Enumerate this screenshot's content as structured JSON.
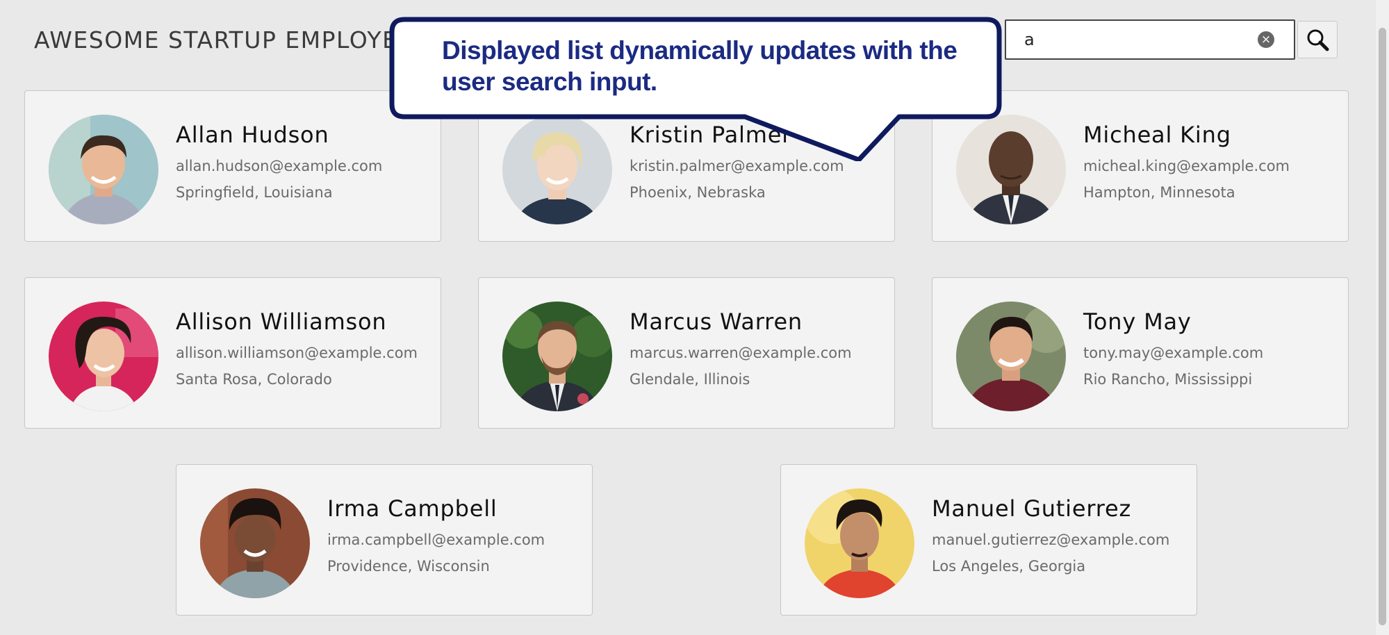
{
  "header": {
    "title": "AWESOME STARTUP EMPLOYEES"
  },
  "search": {
    "value": "a",
    "clear_icon": "clear-icon",
    "search_icon": "magnifier-icon"
  },
  "callout": {
    "text": "Displayed list dynamically updates with the\n user search input."
  },
  "employees": [
    {
      "name": "Allan Hudson",
      "email": "allan.hudson@example.com",
      "location": "Springfield, Louisiana"
    },
    {
      "name": "Kristin Palmer",
      "email": "kristin.palmer@example.com",
      "location": "Phoenix, Nebraska"
    },
    {
      "name": "Micheal King",
      "email": "micheal.king@example.com",
      "location": "Hampton, Minnesota"
    },
    {
      "name": "Allison Williamson",
      "email": "allison.williamson@example.com",
      "location": "Santa Rosa, Colorado"
    },
    {
      "name": "Marcus Warren",
      "email": "marcus.warren@example.com",
      "location": "Glendale, Illinois"
    },
    {
      "name": "Tony May",
      "email": "tony.may@example.com",
      "location": "Rio Rancho, Mississippi"
    },
    {
      "name": "Irma Campbell",
      "email": "irma.campbell@example.com",
      "location": "Providence, Wisconsin"
    },
    {
      "name": "Manuel Gutierrez",
      "email": "manuel.gutierrez@example.com",
      "location": "Los Angeles, Georgia"
    }
  ],
  "colors": {
    "callout_border": "#0f1a5e",
    "callout_text": "#1b2a82",
    "card_bg": "#f3f3f3",
    "page_bg": "#e9e9e9"
  }
}
